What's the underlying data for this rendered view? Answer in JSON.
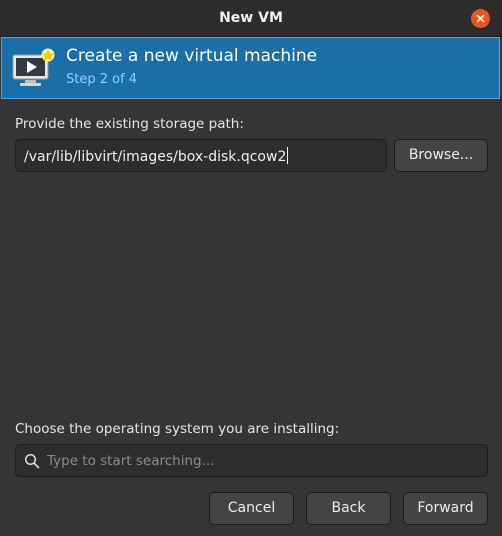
{
  "window": {
    "title": "New VM"
  },
  "header": {
    "title": "Create a new virtual machine",
    "step": "Step 2 of 4",
    "icon": "new-vm-monitor-icon"
  },
  "storage": {
    "label": "Provide the existing storage path:",
    "path_value": "/var/lib/libvirt/images/box-disk.qcow2",
    "browse_label": "Browse..."
  },
  "os": {
    "label": "Choose the operating system you are installing:",
    "search_placeholder": "Type to start searching..."
  },
  "footer": {
    "cancel_label": "Cancel",
    "back_label": "Back",
    "forward_label": "Forward"
  },
  "colors": {
    "accent": "#1b6fa8",
    "close_button": "#e95420"
  }
}
